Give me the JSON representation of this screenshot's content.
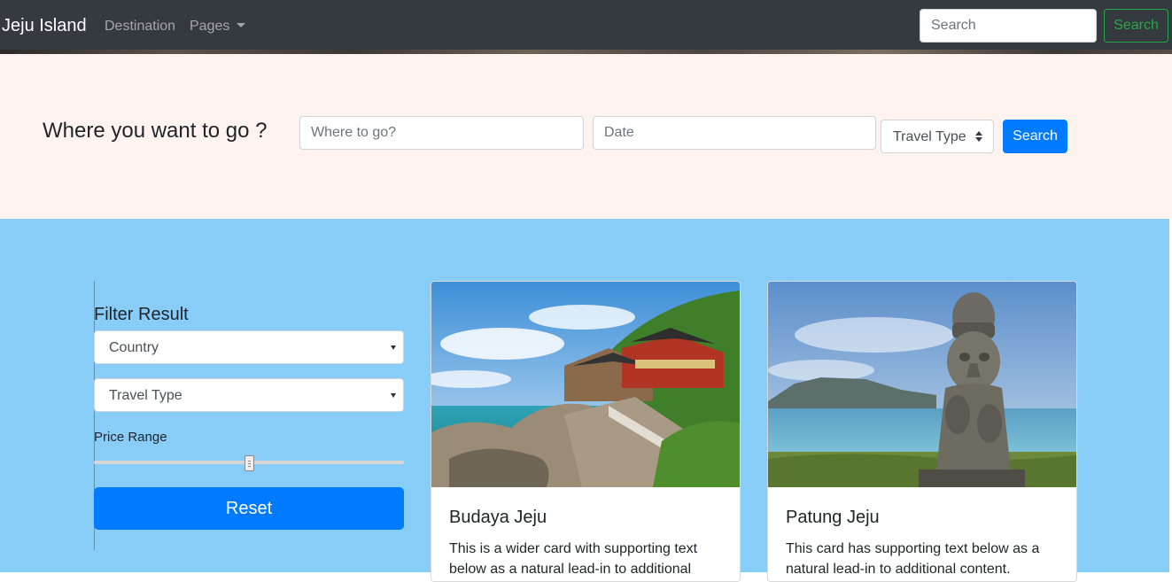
{
  "navbar": {
    "brand": "Jeju Island",
    "links": [
      {
        "label": "Destination"
      },
      {
        "label": "Pages"
      }
    ],
    "search_placeholder": "Search",
    "search_button": "Search"
  },
  "search_section": {
    "title": "Where you want to go ?",
    "where_placeholder": "Where to go?",
    "date_placeholder": "Date",
    "travel_type_selected": "Travel Type",
    "search_button": "Search"
  },
  "filter": {
    "title": "Filter Result",
    "country_selected": "Country",
    "travel_type_selected": "Travel Type",
    "price_label": "Price Range",
    "price_value_fraction": 0.5,
    "reset_button": "Reset"
  },
  "cards": [
    {
      "title": "Budaya Jeju",
      "text": "This is a wider card with supporting text below as a natural lead-in to additional content."
    },
    {
      "title": "Patung Jeju",
      "text": "This card has supporting text below as a natural lead-in to additional content."
    }
  ],
  "colors": {
    "navbar_bg": "#343a40",
    "search_section_bg": "#fff3ef",
    "results_bg": "#87cdf8",
    "primary": "#007bff",
    "success": "#28a745"
  }
}
